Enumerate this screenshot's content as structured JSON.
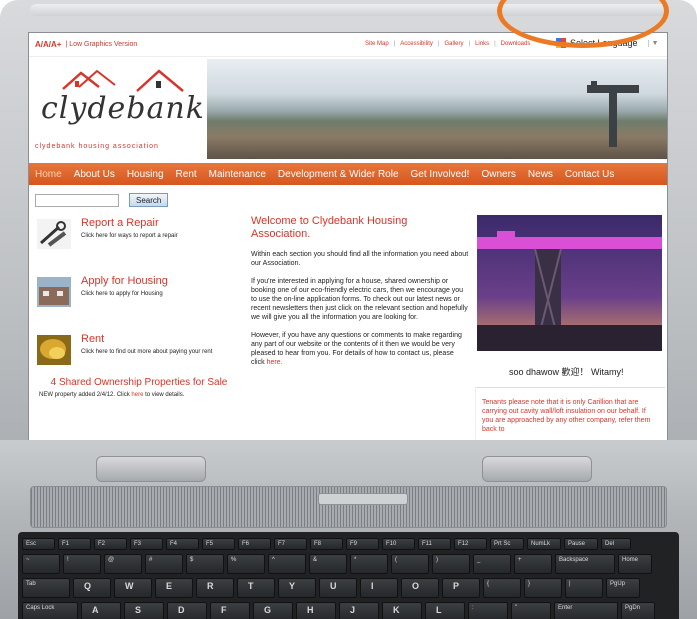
{
  "topbar": {
    "text_size": "A/A/A+",
    "low_graphics": "| Low Graphics Version",
    "links": [
      "Site Map",
      "Accessibility",
      "Gallery",
      "Links",
      "Downloads"
    ],
    "language": "Select Language"
  },
  "logo": {
    "name": "clydebank",
    "tagline": "clydebank housing association"
  },
  "nav": [
    "Home",
    "About Us",
    "Housing",
    "Rent",
    "Maintenance",
    "Development & Wider Role",
    "Get Involved!",
    "Owners",
    "News",
    "Contact Us"
  ],
  "search": {
    "button": "Search",
    "placeholder": ""
  },
  "sidebar": [
    {
      "title": "Report a Repair",
      "desc": "Click here for ways to report a repair"
    },
    {
      "title": "Apply for Housing",
      "desc": "Click here to apply for Housing"
    },
    {
      "title": "Rent",
      "desc": "Click here to find out more about paying your rent"
    }
  ],
  "shared": {
    "title": "4 Shared Ownership Properties for Sale",
    "note_a": "NEW property added 2/4/12.  Click ",
    "note_link": "here",
    "note_b": " to view details."
  },
  "main": {
    "heading": "Welcome to Clydebank Housing Association.",
    "p1": "Within each section you should find all the information you need about our Association.",
    "p2": "If you're interested in applying for a house, shared ownership or booking one of our eco-friendly electric cars, then we encourage you to use the on-line application forms. To check out our latest news or recent newsletters then just click on the relevant section and hopefully we will give you all the information you are looking for.",
    "p3": "However, if you have any questions or comments to make regarding any part of our website or the contents of it then we would be very pleased to hear from you.  For details of how to contact us, please click ",
    "p3_link": "here."
  },
  "right": {
    "greeting": "soo dhawow  歡迎！ Witamy!",
    "notice": "Tenants please note that it is only Carillion that are carrying out cavity wall/loft insulation on our behalf.  If you are approached by any other company, refer them back to"
  },
  "keyboard": {
    "row1": [
      "Esc",
      "F1",
      "F2",
      "F3",
      "F4",
      "F5",
      "F6",
      "F7",
      "F8",
      "F9",
      "F10",
      "F11",
      "F12",
      "Prt Sc",
      "NumLk",
      "Pause",
      "Del"
    ],
    "row2": [
      "~",
      "!",
      "@",
      "#",
      "$",
      "%",
      "^",
      "&",
      "*",
      "(",
      ")",
      "_",
      "+",
      "Backspace",
      "Home"
    ],
    "row3": [
      "Tab",
      "Q",
      "W",
      "E",
      "R",
      "T",
      "Y",
      "U",
      "I",
      "O",
      "P",
      "{",
      "}",
      "|",
      "PgUp"
    ],
    "row4": [
      "Caps Lock",
      "A",
      "S",
      "D",
      "F",
      "G",
      "H",
      "J",
      "K",
      "L",
      ":",
      "\"",
      "Enter",
      "PgDn"
    ]
  },
  "colors": {
    "brand": "#d8352a",
    "nav": "#e06a2e",
    "highlight_ring": "#ec7a24"
  }
}
